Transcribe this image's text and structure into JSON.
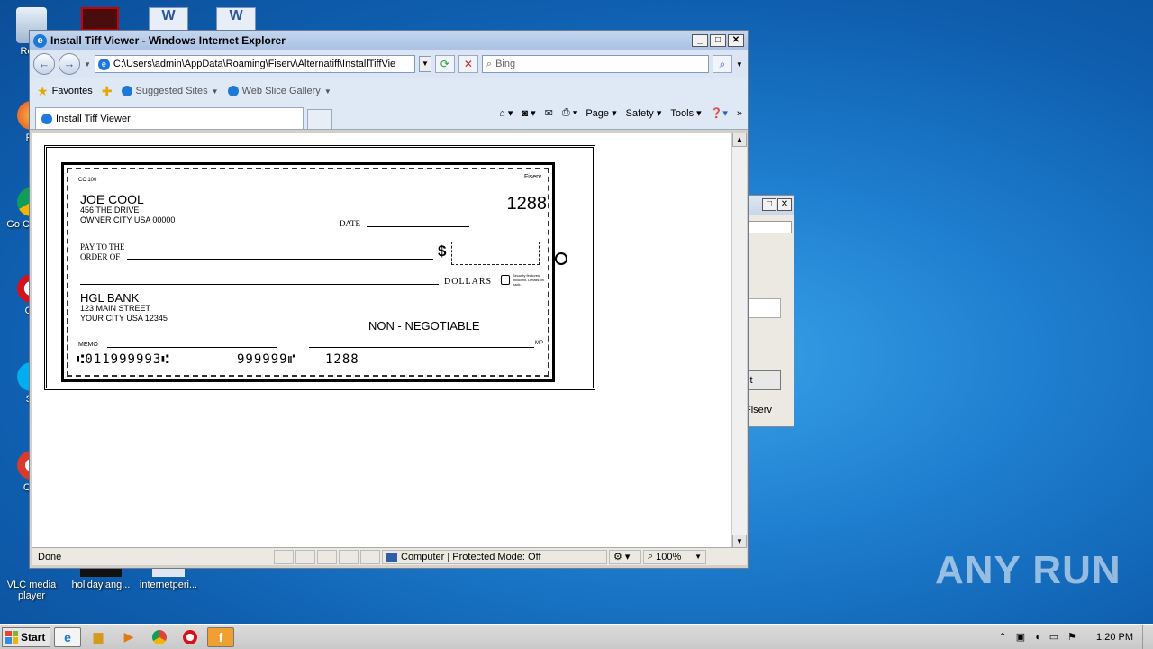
{
  "desktop": {
    "icons": [
      {
        "label": "Recy",
        "icon": "recycle-bin-icon"
      },
      {
        "label": "Fir",
        "icon": "firefox-icon"
      },
      {
        "label": "Go Chr",
        "icon": "chrome-icon"
      },
      {
        "label": "Op",
        "icon": "opera-icon"
      },
      {
        "label": "Sk",
        "icon": "skype-icon"
      },
      {
        "label": "CCl",
        "icon": "ccleaner-icon"
      },
      {
        "label": "VLC media player",
        "icon": "vlc-icon"
      },
      {
        "label": "holidaylang...",
        "icon": "file-icon"
      },
      {
        "label": "internetperi...",
        "icon": "file-icon"
      }
    ]
  },
  "bg_dialog": {
    "button_fragment": "it",
    "text_fragment": "Fiserv"
  },
  "ie": {
    "title": "Install Tiff Viewer - Windows Internet Explorer",
    "address": "C:\\Users\\admin\\AppData\\Roaming\\Fiserv\\Alternatiff\\InstallTiffVie",
    "search_placeholder": "Bing",
    "favorites_label": "Favorites",
    "suggested_sites": "Suggested Sites",
    "web_slice_gallery": "Web Slice Gallery",
    "tab_title": "Install Tiff Viewer",
    "commands": [
      "Page",
      "Safety",
      "Tools"
    ],
    "status_text": "Done",
    "zone_text": "Computer | Protected Mode: Off",
    "zoom": "100%"
  },
  "check": {
    "form_code": "CC 100",
    "brand": "Fiserv",
    "owner_name": "JOE COOL",
    "owner_street": "456 THE DRIVE",
    "owner_city": "OWNER CITY USA 00000",
    "check_number": "1288",
    "date_label": "DATE",
    "pay_label_1": "PAY TO THE",
    "pay_label_2": "ORDER OF",
    "dollar_sign": "$",
    "dollars_label": "DOLLARS",
    "security_note": "Security features included. Details on back.",
    "bank_name": "HGL BANK",
    "bank_street": "123 MAIN STREET",
    "bank_city": "YOUR CITY USA 12345",
    "non_negotiable": "NON - NEGOTIABLE",
    "memo_label": "MEMO",
    "mp_label": "MP",
    "micr_routing": "⑆011999993⑆",
    "micr_account": "999999⑈",
    "micr_check": "1288"
  },
  "taskbar": {
    "start_label": "Start",
    "clock": "1:20 PM"
  },
  "watermark": "ANY RUN"
}
